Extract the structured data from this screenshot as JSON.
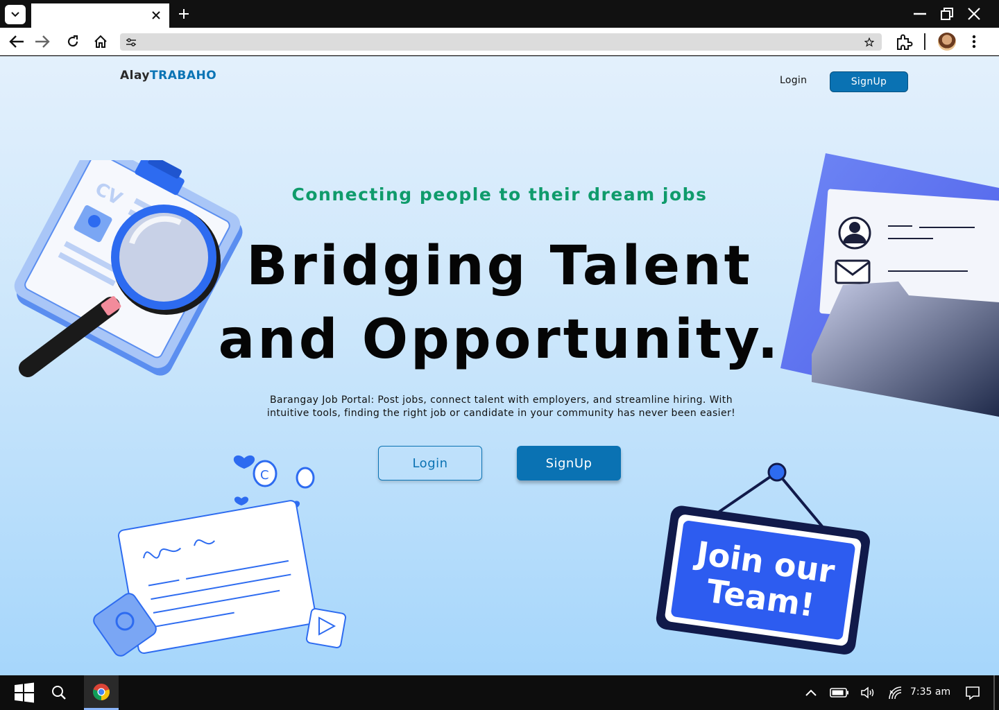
{
  "browser": {
    "tab_title": "",
    "address": "",
    "icons": [
      "tab-search-icon",
      "close-tab-icon",
      "new-tab-icon",
      "minimize-icon",
      "restore-icon",
      "close-window-icon",
      "back-icon",
      "forward-icon",
      "reload-icon",
      "home-icon",
      "site-settings-icon",
      "bookmark-star-icon",
      "extensions-icon",
      "profile-avatar",
      "menu-icon"
    ]
  },
  "header": {
    "brand_part1": "Alay",
    "brand_part2": "TRABAHO",
    "login_label": "Login",
    "signup_label": "SignUp"
  },
  "hero": {
    "tagline": "Connecting people to their dream jobs",
    "headline_line1": "Bridging Talent",
    "headline_line2": "and Opportunity.",
    "description": "Barangay Job Portal: Post jobs, connect talent with employers, and streamline hiring. With intuitive tools, finding the right job or candidate in your community has never been easier!",
    "login_label": "Login",
    "signup_label": "SignUp"
  },
  "illustrations": {
    "cv_label": "CV",
    "sign_text_line1": "Join our",
    "sign_text_line2": "Team!"
  },
  "taskbar": {
    "time": "7:35 am",
    "icons": [
      "start-icon",
      "search-icon",
      "chrome-icon",
      "chevron-up-icon",
      "battery-icon",
      "volume-icon",
      "network-icon",
      "notifications-icon"
    ]
  },
  "colors": {
    "brand_blue": "#0a72b3",
    "tagline_green": "#0f9b6b",
    "page_bg_top": "#e3f0fc",
    "page_bg_bottom": "#a6d6fb"
  }
}
